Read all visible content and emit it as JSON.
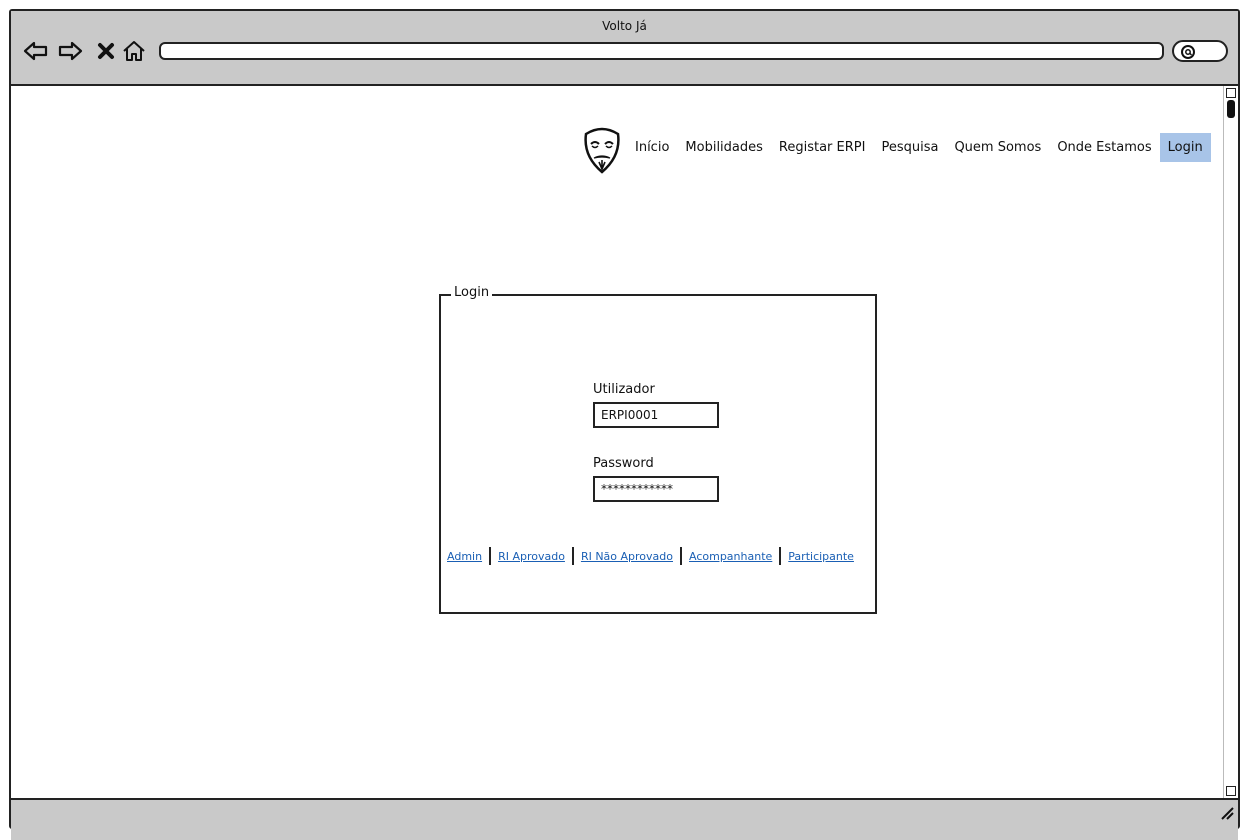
{
  "window": {
    "title": "Volto Já"
  },
  "browser": {
    "nav": [
      {
        "name": "back-icon"
      },
      {
        "name": "forward-icon"
      },
      {
        "name": "close-icon"
      },
      {
        "name": "home-icon"
      }
    ],
    "url": "",
    "search_icon": "search-icon"
  },
  "site_nav": {
    "logo": "mask-logo",
    "items": [
      "Início",
      "Mobilidades",
      "Registar ERPI",
      "Pesquisa",
      "Quem Somos",
      "Onde Estamos",
      "Login"
    ],
    "active": "Login",
    "active_color": "#a8c4e8"
  },
  "login": {
    "legend": "Login",
    "user_label": "Utilizador",
    "user_value": "ERPI0001",
    "password_label": "Password",
    "password_value": "************",
    "links": [
      "Admin",
      "RI Aprovado",
      "RI Não Aprovado",
      "Acompanhante",
      "Participante"
    ],
    "link_color": "#1a5fb4"
  }
}
